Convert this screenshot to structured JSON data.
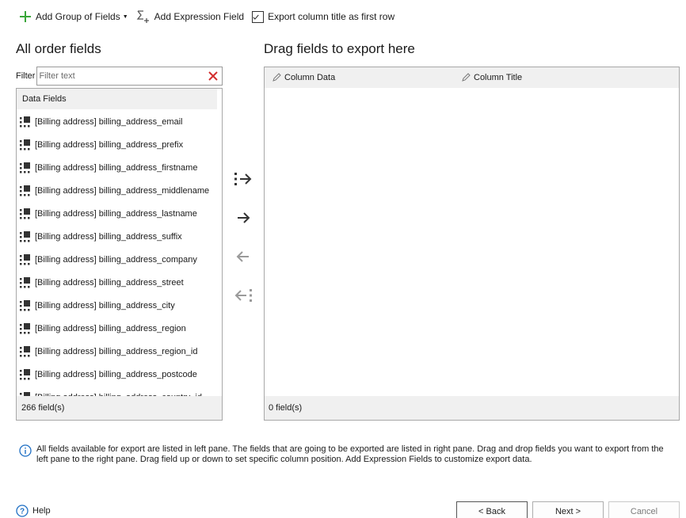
{
  "toolbar": {
    "add_group_label": "Add Group of Fields",
    "add_expression_label": "Add Expression Field",
    "export_title_label": "Export column title as first row",
    "export_title_checked": true
  },
  "left": {
    "title": "All order fields",
    "filter_label": "Filter",
    "filter_placeholder": "Filter text",
    "header": "Data Fields",
    "items": [
      "[Billing address] billing_address_email",
      "[Billing address] billing_address_prefix",
      "[Billing address] billing_address_firstname",
      "[Billing address] billing_address_middlename",
      "[Billing address] billing_address_lastname",
      "[Billing address] billing_address_suffix",
      "[Billing address] billing_address_company",
      "[Billing address] billing_address_street",
      "[Billing address] billing_address_city",
      "[Billing address] billing_address_region",
      "[Billing address] billing_address_region_id",
      "[Billing address] billing_address_postcode",
      "[Billing address] billing_address_country_id"
    ],
    "footer": "266 field(s)"
  },
  "right": {
    "title": "Drag fields to export here",
    "col_data": "Column Data",
    "col_title": "Column Title",
    "footer": "0 field(s)"
  },
  "info_text": "All fields available for export are listed in left pane. The fields that are going to be exported are listed in right pane. Drag and drop fields you want to export from the left pane to the right pane. Drag field up or down to set specific column position. Add Expression Fields to customize export data.",
  "footer": {
    "help": "Help",
    "back": "< Back",
    "next": "Next >",
    "cancel": "Cancel"
  },
  "colors": {
    "accent_green": "#3aa63a",
    "clear_red": "#d32f2f",
    "info_blue": "#1e6fc4",
    "pane_header_bg": "#f0f0f0"
  }
}
